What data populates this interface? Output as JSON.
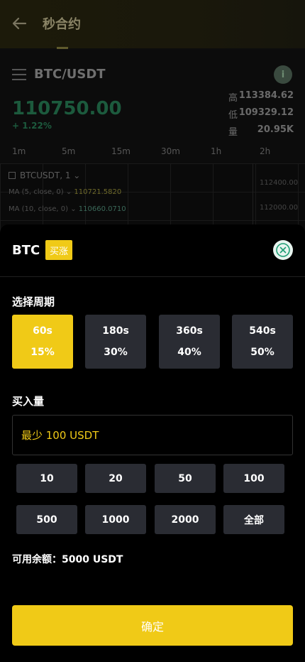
{
  "header": {
    "title": "秒合约"
  },
  "ticker": {
    "pair": "BTC/USDT",
    "price": "110750.00",
    "change": "+ 1.22%",
    "high_label": "高",
    "high_value": "113384.62",
    "low_label": "低",
    "low_value": "109329.12",
    "vol_label": "量",
    "vol_value": "20.95K"
  },
  "intervals": [
    "1m",
    "5m",
    "15m",
    "30m",
    "1h",
    "2h"
  ],
  "chart": {
    "symbol": "BTCUSDT, 1",
    "ma5_label": "MA (5, close, 0)",
    "ma5_value": "110721.5820",
    "ma10_label": "MA (10, close, 0)",
    "ma10_value": "110660.0710",
    "axis": [
      "112400.00",
      "112000.00"
    ]
  },
  "modal": {
    "coin": "BTC",
    "direction": "买涨",
    "period_label": "选择周期",
    "periods": [
      {
        "time": "60s",
        "rate": "15%"
      },
      {
        "time": "180s",
        "rate": "30%"
      },
      {
        "time": "360s",
        "rate": "40%"
      },
      {
        "time": "540s",
        "rate": "50%"
      }
    ],
    "amount_label": "买入量",
    "amount_placeholder": "最少 100 USDT",
    "amounts": [
      "10",
      "20",
      "50",
      "100",
      "500",
      "1000",
      "2000",
      "全部"
    ],
    "balance_label": "可用余额：",
    "balance_value": "5000 USDT",
    "confirm_label": "确定"
  },
  "colors": {
    "accent": "#f0ca17",
    "card": "#2a2c33",
    "up": "#1c5a3d"
  }
}
